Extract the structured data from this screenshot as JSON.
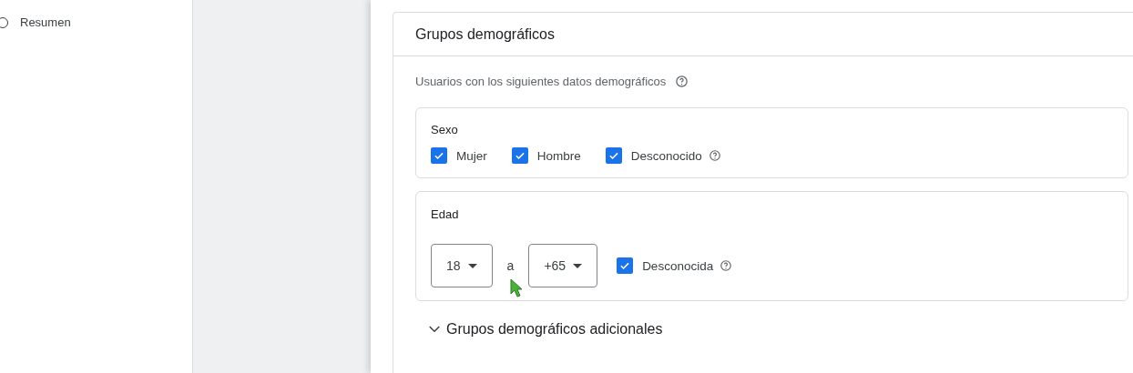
{
  "sidebar": {
    "items": [
      {
        "label": "Resumen",
        "selected": false
      }
    ]
  },
  "card": {
    "title": "Grupos demográficos",
    "description": "Usuarios con los siguientes datos demográficos",
    "sections": [
      {
        "kind": "checkboxes",
        "title": "Sexo",
        "options": [
          {
            "label": "Mujer",
            "checked": true,
            "help": false
          },
          {
            "label": "Hombre",
            "checked": true,
            "help": false
          },
          {
            "label": "Desconocido",
            "checked": true,
            "help": true
          }
        ]
      },
      {
        "kind": "range",
        "title": "Edad",
        "from": "18",
        "separator": "a",
        "to": "+65",
        "unknown": {
          "label": "Desconocida",
          "checked": true,
          "help": true
        }
      }
    ],
    "more": {
      "label": "Grupos demográficos adicionales",
      "expanded": false
    }
  }
}
